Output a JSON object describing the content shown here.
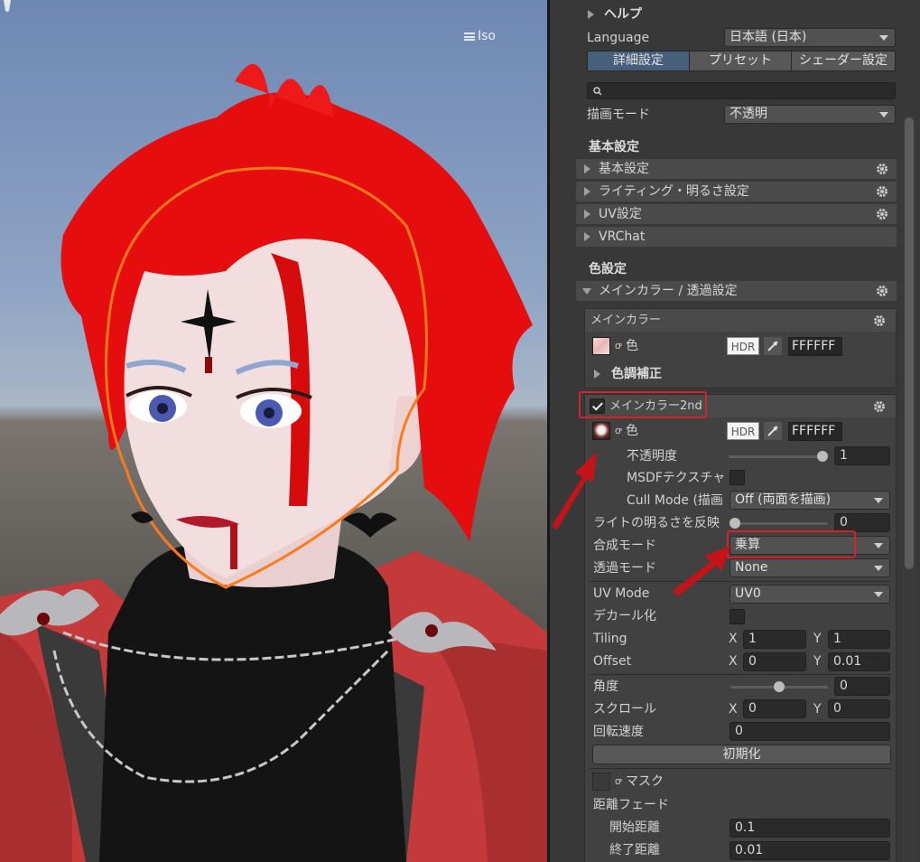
{
  "scene": {
    "view_mode": "Iso",
    "colors": {
      "hair": "#e50d0d",
      "skin": "#f2dede",
      "sky": "#7b93bb",
      "jacket": "#c83a3a",
      "turtleneck": "#141414",
      "outline": "#ff7a1a"
    }
  },
  "inspector": {
    "help": "ヘルプ",
    "language_label": "Language",
    "language_value": "日本語 (日本)",
    "tabs": [
      "詳細設定",
      "プリセット",
      "シェーダー設定"
    ],
    "active_tab": 0,
    "search_placeholder": "",
    "render_mode_label": "描画モード",
    "render_mode_value": "不透明",
    "basic_header": "基本設定",
    "basic_foldouts": [
      {
        "label": "基本設定",
        "gear": true
      },
      {
        "label": "ライティング・明るさ設定",
        "gear": true
      },
      {
        "label": "UV設定",
        "gear": true
      },
      {
        "label": "VRChat",
        "gear": false
      }
    ],
    "color_header": "色設定",
    "main_color_section": "メインカラー / 透過設定",
    "main_color": {
      "title": "メインカラー",
      "color_label": "色",
      "hdr": "HDR",
      "hex": "FFFFFF",
      "tone_correction": "色調補正"
    },
    "main_color_2nd": {
      "title": "メインカラー2nd",
      "enabled": true,
      "color_label": "色",
      "hdr": "HDR",
      "hex": "FFFFFF",
      "opacity_label": "不透明度",
      "opacity_value": "1",
      "msdf_label": "MSDFテクスチャ",
      "cull_label": "Cull Mode (描画",
      "cull_value": "Off (両面を描画)",
      "light_label": "ライトの明るさを反映",
      "light_value": "0",
      "blend_label": "合成モード",
      "blend_value": "乗算",
      "alpha_label": "透過モード",
      "alpha_value": "None",
      "uv_label": "UV Mode",
      "uv_value": "UV0",
      "decal_label": "デカール化",
      "tiling_label": "Tiling",
      "tiling_x": "1",
      "tiling_y": "1",
      "offset_label": "Offset",
      "offset_x": "0",
      "offset_y": "0.01",
      "angle_label": "角度",
      "angle_value": "0",
      "scroll_label": "スクロール",
      "scroll_x": "0",
      "scroll_y": "0",
      "rotation_label": "回転速度",
      "rotation_value": "0",
      "x_label": "X",
      "y_label": "Y",
      "reset_button": "初期化",
      "mask_label": "マスク",
      "distance_fade_label": "距離フェード",
      "fade_start_label": "開始距離",
      "fade_start_value": "0.1",
      "fade_end_label": "終了距離",
      "fade_end_value": "0.01"
    },
    "highlight_color": "#d5232a",
    "active_tab_color": "#46607c"
  }
}
